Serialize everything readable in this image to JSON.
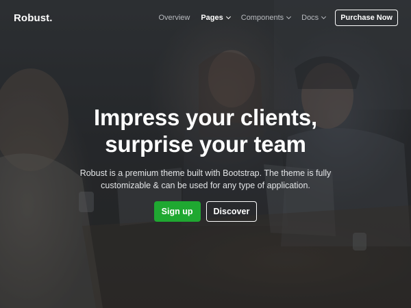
{
  "navbar": {
    "brand": "Robust.",
    "links": [
      {
        "label": "Overview",
        "has_dropdown": false,
        "active": false
      },
      {
        "label": "Pages",
        "has_dropdown": true,
        "active": true
      },
      {
        "label": "Components",
        "has_dropdown": true,
        "active": false
      },
      {
        "label": "Docs",
        "has_dropdown": true,
        "active": false
      }
    ],
    "purchase_label": "Purchase Now"
  },
  "hero": {
    "headline_line1": "Impress your clients,",
    "headline_line2": "surprise your team",
    "subtext_line1": "Robust is a premium theme built with Bootstrap. The theme is fully",
    "subtext_line2": "customizable & can be used for any type of application.",
    "signup_label": "Sign up",
    "discover_label": "Discover",
    "background_image": "people-laughing-at-table-photo"
  },
  "colors": {
    "accent_green": "#1fa831",
    "text_white": "#ffffff",
    "nav_muted": "#b9bcc0"
  }
}
